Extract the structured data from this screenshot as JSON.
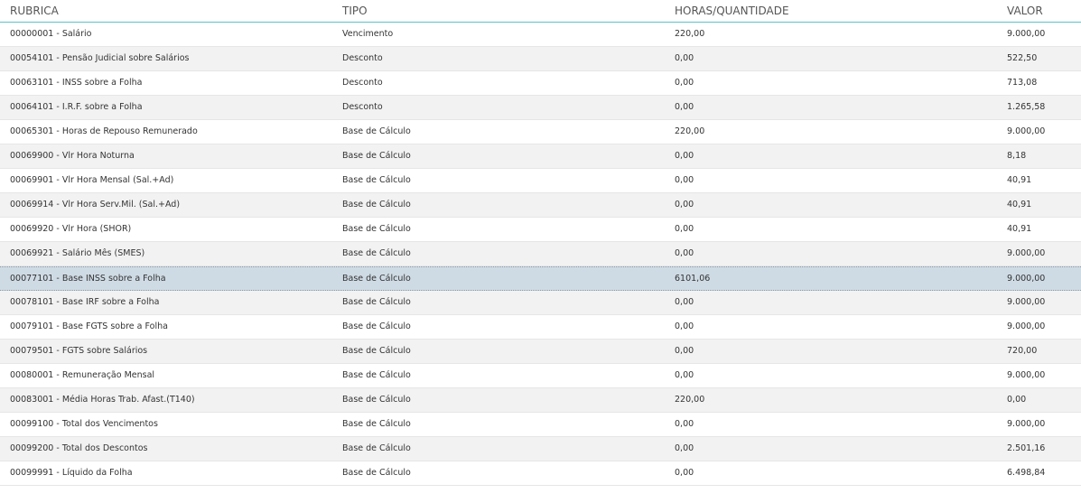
{
  "table": {
    "columns": [
      "RUBRICA",
      "TIPO",
      "HORAS/QUANTIDADE",
      "VALOR"
    ],
    "rows": [
      {
        "rubrica": "00000001 - Salário",
        "tipo": "Vencimento",
        "horas": "220,00",
        "valor": "9.000,00",
        "selected": false
      },
      {
        "rubrica": "00054101 - Pensão Judicial sobre Salários",
        "tipo": "Desconto",
        "horas": "0,00",
        "valor": "522,50",
        "selected": false
      },
      {
        "rubrica": "00063101 - INSS sobre a Folha",
        "tipo": "Desconto",
        "horas": "0,00",
        "valor": "713,08",
        "selected": false
      },
      {
        "rubrica": "00064101 - I.R.F. sobre a Folha",
        "tipo": "Desconto",
        "horas": "0,00",
        "valor": "1.265,58",
        "selected": false
      },
      {
        "rubrica": "00065301 - Horas de Repouso Remunerado",
        "tipo": "Base de Cálculo",
        "horas": "220,00",
        "valor": "9.000,00",
        "selected": false
      },
      {
        "rubrica": "00069900 - Vlr Hora Noturna",
        "tipo": "Base de Cálculo",
        "horas": "0,00",
        "valor": "8,18",
        "selected": false
      },
      {
        "rubrica": "00069901 - Vlr Hora Mensal (Sal.+Ad)",
        "tipo": "Base de Cálculo",
        "horas": "0,00",
        "valor": "40,91",
        "selected": false
      },
      {
        "rubrica": "00069914 - Vlr Hora Serv.Mil. (Sal.+Ad)",
        "tipo": "Base de Cálculo",
        "horas": "0,00",
        "valor": "40,91",
        "selected": false
      },
      {
        "rubrica": "00069920 - Vlr Hora (SHOR)",
        "tipo": "Base de Cálculo",
        "horas": "0,00",
        "valor": "40,91",
        "selected": false
      },
      {
        "rubrica": "00069921 - Salário Mês (SMES)",
        "tipo": "Base de Cálculo",
        "horas": "0,00",
        "valor": "9.000,00",
        "selected": false
      },
      {
        "rubrica": "00077101 - Base INSS sobre a Folha",
        "tipo": "Base de Cálculo",
        "horas": "6101,06",
        "valor": "9.000,00",
        "selected": true
      },
      {
        "rubrica": "00078101 - Base IRF sobre a Folha",
        "tipo": "Base de Cálculo",
        "horas": "0,00",
        "valor": "9.000,00",
        "selected": false
      },
      {
        "rubrica": "00079101 - Base FGTS sobre a Folha",
        "tipo": "Base de Cálculo",
        "horas": "0,00",
        "valor": "9.000,00",
        "selected": false
      },
      {
        "rubrica": "00079501 - FGTS sobre Salários",
        "tipo": "Base de Cálculo",
        "horas": "0,00",
        "valor": "720,00",
        "selected": false
      },
      {
        "rubrica": "00080001 - Remuneração Mensal",
        "tipo": "Base de Cálculo",
        "horas": "0,00",
        "valor": "9.000,00",
        "selected": false
      },
      {
        "rubrica": "00083001 - Média Horas Trab. Afast.(T140)",
        "tipo": "Base de Cálculo",
        "horas": "220,00",
        "valor": "0,00",
        "selected": false
      },
      {
        "rubrica": "00099100 - Total dos Vencimentos",
        "tipo": "Base de Cálculo",
        "horas": "0,00",
        "valor": "9.000,00",
        "selected": false
      },
      {
        "rubrica": "00099200 - Total dos Descontos",
        "tipo": "Base de Cálculo",
        "horas": "0,00",
        "valor": "2.501,16",
        "selected": false
      },
      {
        "rubrica": "00099991 - Líquido da Folha",
        "tipo": "Base de Cálculo",
        "horas": "0,00",
        "valor": "6.498,84",
        "selected": false
      }
    ]
  },
  "colors": {
    "header_border": "#5bc0c9",
    "row_alt": "#f2f2f2",
    "row_selected": "#cfdbe4"
  }
}
